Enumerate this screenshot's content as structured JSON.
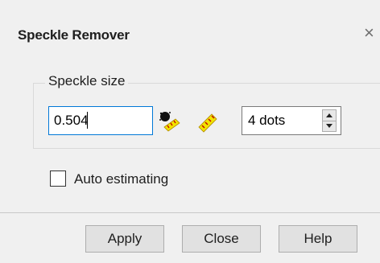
{
  "dialog": {
    "title": "Speckle Remover",
    "close_glyph": "×"
  },
  "speckle_group": {
    "label": "Speckle size",
    "size_value": "0.504",
    "dots_value": "4 dots"
  },
  "icons": {
    "estimate_icon": "speckle-estimate-icon",
    "ruler_icon": "measure-ruler-icon"
  },
  "auto_estimating": {
    "label": "Auto estimating",
    "checked": false
  },
  "buttons": {
    "apply": "Apply",
    "close": "Close",
    "help": "Help"
  }
}
